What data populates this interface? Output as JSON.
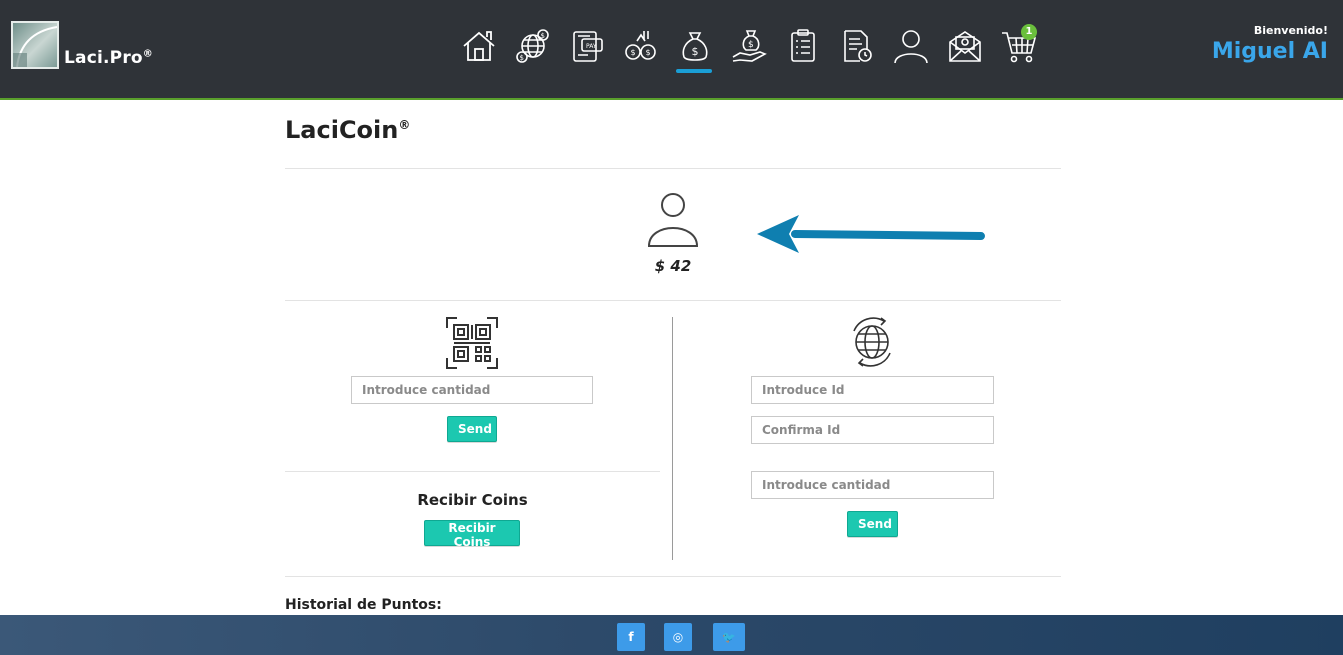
{
  "brand": {
    "name": "Laci.Pro",
    "mark": "®"
  },
  "header": {
    "greeting": "Bienvenido!",
    "user_name": "Miguel AI",
    "cart_count": "1"
  },
  "nav_icons": [
    "home-icon",
    "global-exchange-icon",
    "pay-wallet-icon",
    "coins-exchange-icon",
    "money-bag-icon",
    "money-hand-icon",
    "clipboard-list-icon",
    "document-clock-icon",
    "user-icon",
    "mail-icon",
    "cart-icon"
  ],
  "page": {
    "title": "LaciCoin",
    "title_mark": "®",
    "balance": "$ 42"
  },
  "left_panel": {
    "amount_placeholder": "Introduce cantidad",
    "send_label": "Send",
    "receive_title": "Recibir Coins",
    "receive_button": "Recibir Coins"
  },
  "right_panel": {
    "id_placeholder": "Introduce Id",
    "confirm_placeholder": "Confirma Id",
    "amount_placeholder": "Introduce cantidad",
    "send_label": "Send"
  },
  "history_title": "Historial de Puntos:",
  "footer": {
    "social": [
      {
        "name": "facebook",
        "glyph": "f"
      },
      {
        "name": "instagram",
        "glyph": "◎"
      },
      {
        "name": "twitter",
        "glyph": "🐦"
      }
    ]
  },
  "colors": {
    "header_bg": "#2f3338",
    "accent_blue": "#1a9fd6",
    "button_teal": "#1cc8b0",
    "arrow_blue": "#0f7fb0",
    "badge_green": "#6abf3c"
  }
}
